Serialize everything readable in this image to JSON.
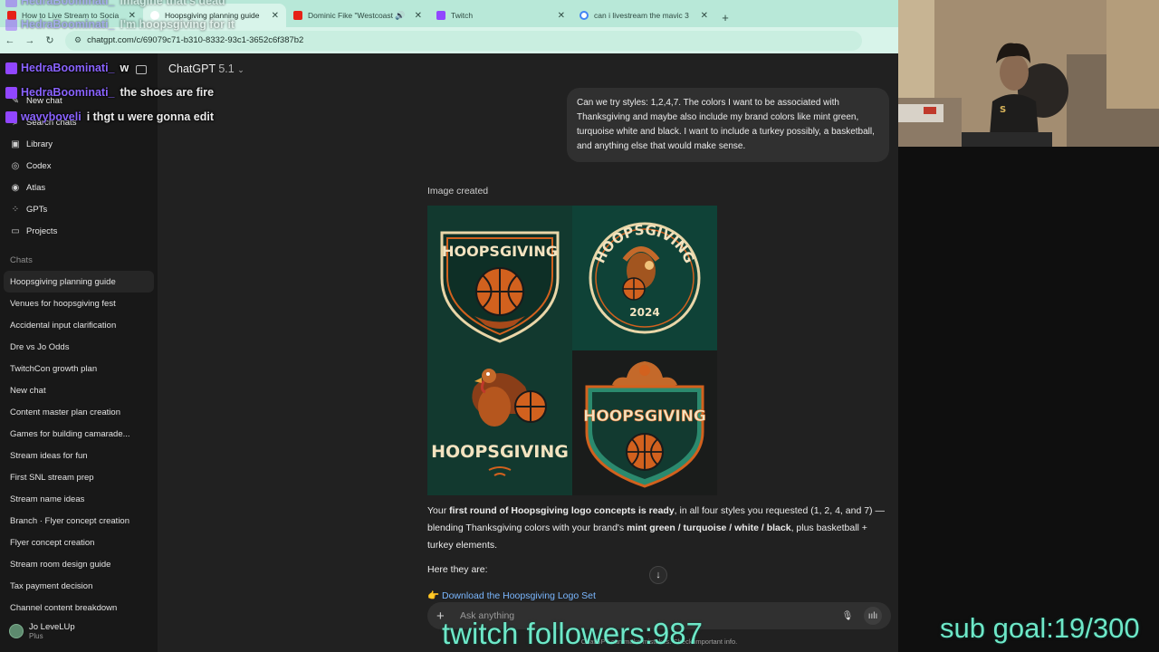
{
  "browser": {
    "tabs": [
      {
        "title": "How to Live Stream to Socia",
        "favicon": "youtube-icon",
        "color": "#e62117"
      },
      {
        "title": "Hoopsgiving planning guide",
        "favicon": "chatgpt-icon",
        "color": "#ffffff",
        "active": true
      },
      {
        "title": "Dominic Fike \"Westcoast",
        "favicon": "youtube-icon",
        "color": "#e62117"
      },
      {
        "title": "Twitch",
        "favicon": "twitch-icon",
        "color": "#9146ff"
      },
      {
        "title": "can i livestream the mavic 3",
        "favicon": "google-icon",
        "color": "#4285f4"
      }
    ],
    "url": "chatgpt.com/c/69079c71-b310-8332-93c1-3652c6f387b2"
  },
  "sidebar": {
    "nav": [
      {
        "label": "New chat",
        "icon": "compose-icon"
      },
      {
        "label": "Search chats",
        "icon": "search-icon"
      },
      {
        "label": "Library",
        "icon": "library-icon"
      },
      {
        "label": "Codex",
        "icon": "codex-icon"
      },
      {
        "label": "Atlas",
        "icon": "atlas-icon"
      },
      {
        "label": "GPTs",
        "icon": "gpts-icon"
      },
      {
        "label": "Projects",
        "icon": "folder-icon"
      }
    ],
    "chats_label": "Chats",
    "chats": [
      "Hoopsgiving planning guide",
      "Venues for hoopsgiving fest",
      "Accidental input clarification",
      "Dre vs Jo Odds",
      "TwitchCon growth plan",
      "New chat",
      "Content master plan creation",
      "Games for building camarade...",
      "Stream ideas for fun",
      "First SNL stream prep",
      "Stream name ideas",
      "Branch · Flyer concept creation",
      "Flyer concept creation",
      "Stream room design guide",
      "Tax payment decision",
      "Channel content breakdown"
    ],
    "user": {
      "name": "Jo LeveLUp",
      "plan": "Plus"
    }
  },
  "main": {
    "model_name": "ChatGPT",
    "model_version": "5.1",
    "user_message": "Can we try styles: 1,2,4,7. The colors I want to be associated with Thanksgiving and maybe also include my brand colors like mint green, turquoise white and black. I want to include a turkey possibly, a basketball, and anything else that would make sense.",
    "image_created_label": "Image created",
    "logos": [
      {
        "text": "HOOPSGIVING"
      },
      {
        "text": "HOOPSGIVING",
        "year": "2024"
      },
      {
        "text": "HOOPSGIVING"
      },
      {
        "text": "HOOPSGIVING"
      }
    ],
    "reply": {
      "p1": "Your ",
      "b1": "first round of Hoopsgiving logo concepts is ready",
      "p2": ", in all four styles you requested (1, 2, 4, and 7) — blending Thanksgiving colors with your brand's ",
      "b2": "mint green / turquoise / white / black",
      "p3": ", plus basketball + turkey elements."
    },
    "here_they_are": "Here they are:",
    "download_link": "👉 Download the Hoopsgiving Logo Set",
    "composer_placeholder": "Ask anything",
    "disclaimer": "ChatGPT can make mistakes. Check important info."
  },
  "overlay": {
    "chat_messages": [
      {
        "user": "HedraBoominati_",
        "message": "imagine that's dead",
        "faint": true
      },
      {
        "user": "HedraBoominati_",
        "message": "I'm hoopsgiving for it",
        "faint": true
      },
      {
        "user": "HedraBoominati_",
        "message": "w",
        "faint": false
      },
      {
        "user": "HedraBoominati_",
        "message": "the shoes are fire",
        "faint": false
      },
      {
        "user": "wavyboveli",
        "message": "i thgt u were gonna edit",
        "faint": false
      }
    ],
    "followers_text": "twitch followers:987",
    "sub_goal_text": "sub goal:19/300"
  },
  "colors": {
    "mint": "#6de8c8",
    "logo_teal": "#0e3a2f",
    "logo_orange": "#d2611e",
    "logo_cream": "#f3e3c0"
  }
}
